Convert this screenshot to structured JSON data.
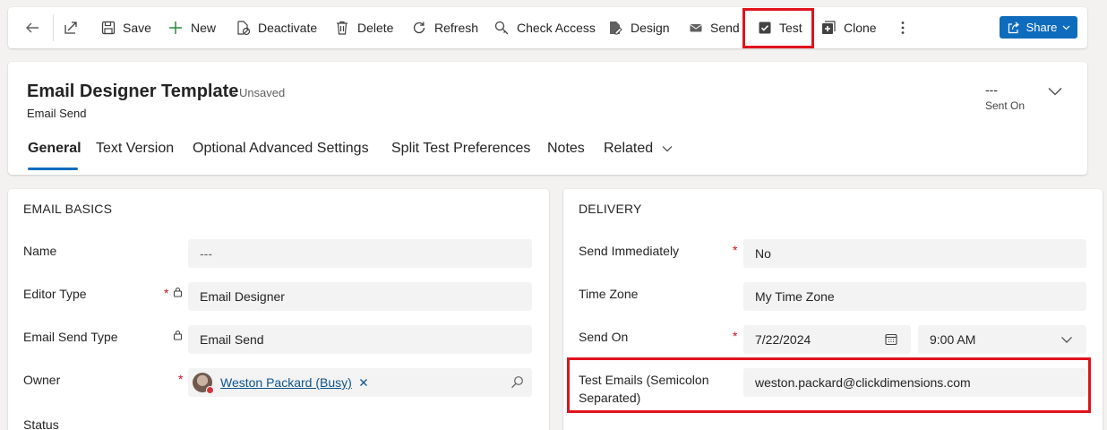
{
  "toolbar": {
    "save": "Save",
    "new": "New",
    "deactivate": "Deactivate",
    "delete": "Delete",
    "refresh": "Refresh",
    "check_access": "Check Access",
    "design": "Design",
    "send": "Send",
    "test": "Test",
    "clone": "Clone",
    "share": "Share",
    "icons": [
      "back-icon",
      "popout-icon",
      "save-icon",
      "plus-icon",
      "deactivate-icon",
      "trash-icon",
      "refresh-icon",
      "check-access-icon",
      "design-icon",
      "mail-icon",
      "checkbox-icon",
      "clone-icon",
      "more-icon",
      "share-icon",
      "chevron-down-icon"
    ]
  },
  "header": {
    "title": "Email Designer Template",
    "status": "- Unsaved",
    "entity": "Email Send",
    "sent_on_value": "---",
    "sent_on_label": "Sent On"
  },
  "tabs": [
    {
      "label": "General",
      "active": true
    },
    {
      "label": "Text Version"
    },
    {
      "label": "Optional Advanced Settings"
    },
    {
      "label": "Split Test Preferences"
    },
    {
      "label": "Notes"
    },
    {
      "label": "Related"
    }
  ],
  "email_basics": {
    "title": "EMAIL BASICS",
    "name_label": "Name",
    "name_value": "---",
    "editor_type_label": "Editor Type",
    "editor_type_value": "Email Designer",
    "send_type_label": "Email Send Type",
    "send_type_value": "Email Send",
    "owner_label": "Owner",
    "owner_value": "Weston Packard (Busy)",
    "status_label": "Status"
  },
  "delivery": {
    "title": "DELIVERY",
    "send_immediately_label": "Send Immediately",
    "send_immediately_value": "No",
    "time_zone_label": "Time Zone",
    "time_zone_value": "My Time Zone",
    "send_on_label": "Send On",
    "send_on_date": "7/22/2024",
    "send_on_time": "9:00 AM",
    "test_emails_label_line1": "Test Emails (Semicolon",
    "test_emails_label_line2": "Separated)",
    "test_emails_value": "weston.packard@clickdimensions.com"
  },
  "colors": {
    "accent": "#0f6cbd",
    "highlight": "#e0121d",
    "required": "#c50f1f",
    "presence_busy": "#d13438"
  }
}
